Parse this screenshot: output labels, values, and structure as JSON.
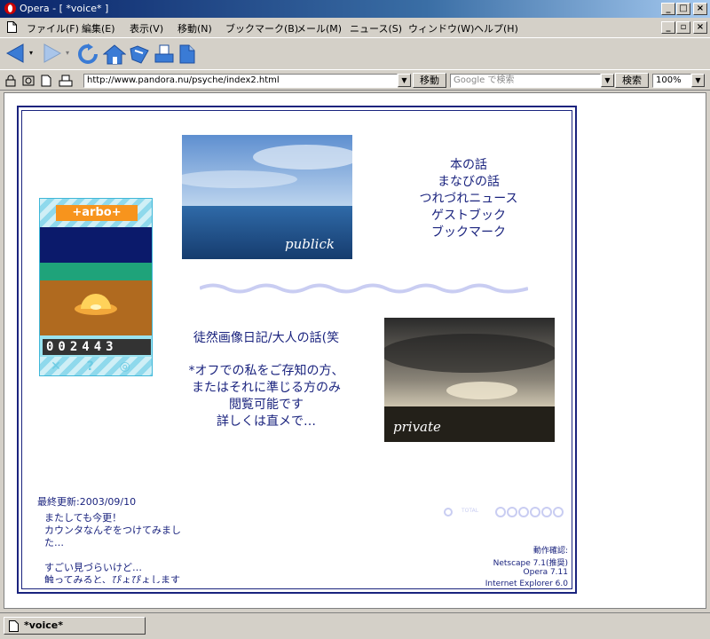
{
  "window": {
    "app_name": "Opera",
    "title": "Opera - [ *voice* ]",
    "controls": {
      "minimize": "_",
      "maximize": "□",
      "close": "×",
      "restore": "▫"
    }
  },
  "menu": [
    "ファイル(F)",
    "編集(E)",
    "表示(V)",
    "移動(N)",
    "ブックマーク(B)",
    "メール(M)",
    "ニュース(S)",
    "ウィンドウ(W)",
    "ヘルプ(H)"
  ],
  "address_bar": {
    "url": "http://www.pandora.nu/psyche/index2.html",
    "go_label": "移動",
    "search_placeholder": "Google で検索",
    "search_label": "検索",
    "zoom": "100%"
  },
  "counter": {
    "logo": "+arbo+",
    "digits": "002443",
    "footer": "✕ ? ◎"
  },
  "photos": {
    "public_caption": "publick",
    "private_caption": "private"
  },
  "nav_links": [
    "本の話",
    "まなびの話",
    "つれづれニュース",
    "ゲストブック",
    "ブックマーク"
  ],
  "diary": {
    "title": "徒然画像日記/大人の話(笑",
    "notes": [
      "*オフでの私をご存知の方、",
      "またはそれに準じる方のみ",
      "閲覧可能です",
      "詳しくは直メで…"
    ]
  },
  "update": {
    "title": "最終更新:2003/09/10",
    "lines": [
      "またしても今更！",
      "カウンタなんぞをつけてみまし",
      "た…",
      "",
      "すごい見づらいけど…",
      "触ってみると、ぴょぴょします"
    ]
  },
  "total": {
    "label": "TOTAL"
  },
  "compat": {
    "title": "動作確認:",
    "browsers": [
      "Netscape 7.1(推奨)",
      "Opera 7.11",
      "Internet Explorer 6.0"
    ]
  },
  "status": {
    "tab_label": "*voice*"
  },
  "colors": {
    "titlebar": "#0a246a",
    "link": "#1a237e",
    "chrome": "#d4d0c8"
  }
}
